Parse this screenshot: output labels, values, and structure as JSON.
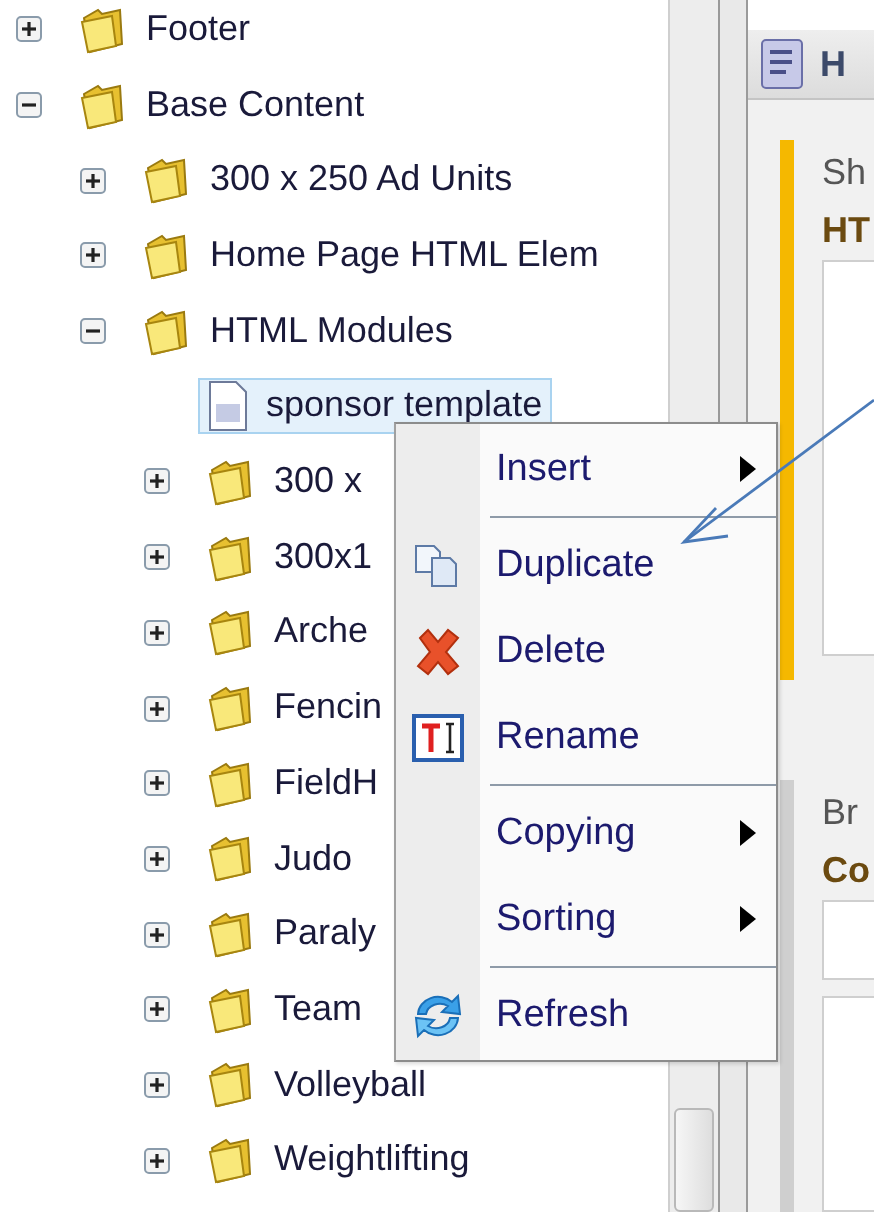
{
  "tree": [
    {
      "kind": "folder",
      "label": "Footer",
      "expanded": false,
      "selected": false
    },
    {
      "kind": "folder",
      "label": "Base Content",
      "expanded": true,
      "selected": false,
      "children": [
        {
          "kind": "folder",
          "label": "300 x 250 Ad Units",
          "expanded": false,
          "selected": false
        },
        {
          "kind": "folder",
          "label": "Home Page HTML Elem",
          "expanded": false,
          "selected": false
        },
        {
          "kind": "folder",
          "label": "HTML Modules",
          "expanded": true,
          "selected": false,
          "children": [
            {
              "kind": "document",
              "label": "sponsor template",
              "selected": true
            },
            {
              "kind": "folder",
              "label": "300 x",
              "expanded": false,
              "selected": false
            },
            {
              "kind": "folder",
              "label": "300x1",
              "expanded": false,
              "selected": false
            },
            {
              "kind": "folder",
              "label": "Arche",
              "expanded": false,
              "selected": false
            },
            {
              "kind": "folder",
              "label": "Fencin",
              "expanded": false,
              "selected": false
            },
            {
              "kind": "folder",
              "label": "FieldH",
              "expanded": false,
              "selected": false
            },
            {
              "kind": "folder",
              "label": "Judo",
              "expanded": false,
              "selected": false
            },
            {
              "kind": "folder",
              "label": "Paraly",
              "expanded": false,
              "selected": false
            },
            {
              "kind": "folder",
              "label": "Team",
              "expanded": false,
              "selected": false
            },
            {
              "kind": "folder",
              "label": "Volleyball",
              "expanded": false,
              "selected": false
            },
            {
              "kind": "folder",
              "label": "Weightlifting",
              "expanded": false,
              "selected": false
            }
          ]
        }
      ]
    }
  ],
  "context_menu": [
    {
      "kind": "submenu",
      "label": "Insert"
    },
    {
      "kind": "separator"
    },
    {
      "kind": "command",
      "label": "Duplicate"
    },
    {
      "kind": "command",
      "label": "Delete"
    },
    {
      "kind": "command",
      "label": "Rename"
    },
    {
      "kind": "separator"
    },
    {
      "kind": "submenu",
      "label": "Copying"
    },
    {
      "kind": "submenu",
      "label": "Sorting"
    },
    {
      "kind": "separator"
    },
    {
      "kind": "command",
      "label": "Refresh"
    }
  ],
  "editor": {
    "title": "H",
    "sections": [
      {
        "label": "Sh",
        "field_label": "HT",
        "color": "#f5b800"
      },
      {
        "label": "Br",
        "field_label": "Co",
        "color": "#cfcfcf"
      }
    ]
  }
}
